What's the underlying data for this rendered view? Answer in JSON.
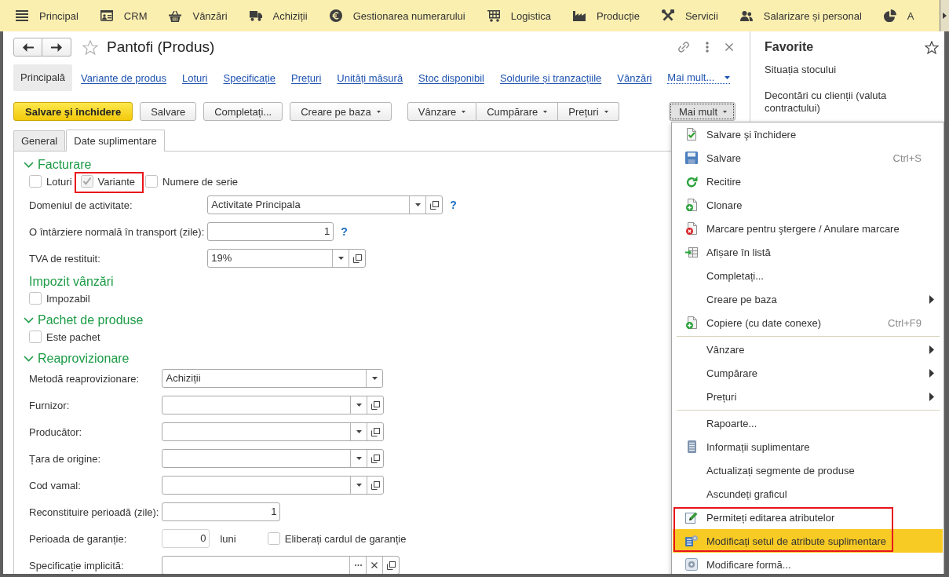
{
  "top_nav": {
    "sections": [
      {
        "label": "Principal"
      },
      {
        "label": "CRM"
      },
      {
        "label": "Vânzări"
      },
      {
        "label": "Achiziții"
      },
      {
        "label": "Gestionarea numerarului"
      },
      {
        "label": "Logistica"
      },
      {
        "label": "Producție"
      },
      {
        "label": "Servicii"
      },
      {
        "label": "Salarizare și personal"
      },
      {
        "label": "A"
      }
    ]
  },
  "form": {
    "title": "Pantofi (Produs)",
    "favorite": false,
    "nav_links": [
      {
        "label": "Principală",
        "selected": true
      },
      {
        "label": "Variante de produs",
        "selected": false
      },
      {
        "label": "Loturi",
        "selected": false
      },
      {
        "label": "Specificație",
        "selected": false
      },
      {
        "label": "Prețuri",
        "selected": false
      },
      {
        "label": "Unități măsură",
        "selected": false
      },
      {
        "label": "Stoc disponibil",
        "selected": false
      },
      {
        "label": "Soldurile și tranzacțiile",
        "selected": false
      },
      {
        "label": "Vânzări",
        "selected": false
      }
    ],
    "nav_more": {
      "label": "Mai mult..."
    },
    "toolbar": {
      "buttons": [
        {
          "label": "Salvare şi închidere",
          "kind": "primary",
          "pressed": false
        },
        {
          "label": "Salvare",
          "kind": "plain",
          "pressed": false
        },
        {
          "label": "Completați...",
          "kind": "plain",
          "pressed": false
        },
        {
          "label": "Creare pe baza",
          "kind": "dropdown",
          "pressed": false
        }
      ],
      "group": [
        {
          "label": "Vânzare",
          "kind": "dropdown",
          "pressed": false
        },
        {
          "label": "Cumpărare",
          "kind": "dropdown",
          "pressed": false
        },
        {
          "label": "Prețuri",
          "kind": "dropdown",
          "pressed": false
        }
      ],
      "more": {
        "label": "Mai mult",
        "kind": "dropdown",
        "pressed": true
      }
    },
    "tabs": [
      {
        "label": "General",
        "selected": false
      },
      {
        "label": "Date suplimentare",
        "selected": true
      }
    ],
    "sections": [
      {
        "title": "Facturare",
        "collapsible": true,
        "expanded": true,
        "rows": [
          {
            "kind": "checkboxes",
            "items": [
              {
                "label": "Loturi",
                "checked": false,
                "disabled": false,
                "highlighted": false
              },
              {
                "label": "Variante",
                "checked": true,
                "disabled": true,
                "highlighted": true
              },
              {
                "label": "Numere de serie",
                "checked": false,
                "disabled": false,
                "highlighted": false
              }
            ]
          },
          {
            "kind": "reference",
            "label": "Domeniul de activitate:",
            "value": "Activitate Principala",
            "help": "?"
          },
          {
            "kind": "number",
            "label": "O întârziere normală în transport (zile):",
            "value": "1",
            "help": "?"
          },
          {
            "kind": "reference",
            "label": "TVA de restituit:",
            "value": "19%"
          }
        ]
      },
      {
        "title": "Impozit vânzări",
        "collapsible": false,
        "rows": [
          {
            "kind": "checkboxes",
            "items": [
              {
                "label": "Impozabil",
                "checked": false,
                "disabled": false,
                "highlighted": false
              }
            ]
          }
        ]
      },
      {
        "title": "Pachet de produse",
        "collapsible": true,
        "expanded": true,
        "rows": [
          {
            "kind": "checkboxes",
            "items": [
              {
                "label": "Este pachet",
                "checked": false,
                "disabled": false,
                "highlighted": false
              }
            ]
          }
        ]
      },
      {
        "title": "Reaprovizionare",
        "collapsible": true,
        "expanded": true,
        "rows": [
          {
            "kind": "enum",
            "label": "Metodă reaprovizionare:",
            "value": "Achiziții"
          },
          {
            "kind": "reference",
            "label": "Furnizor:"
          },
          {
            "kind": "reference",
            "label": "Producător:"
          },
          {
            "kind": "reference",
            "label": "Țara de origine:"
          },
          {
            "kind": "reference",
            "label": "Cod vamal:"
          },
          {
            "kind": "number",
            "label": "Reconstituire perioadă (zile):",
            "value": "1"
          },
          {
            "kind": "number",
            "label": "Perioada de garanție:",
            "value": "0",
            "unit": "luni",
            "checkbox": {
              "label": "Eliberați cardul de garanție",
              "checked": false,
              "disabled": false,
              "highlighted": false
            }
          },
          {
            "kind": "picker",
            "label": "Specificație implicită:"
          }
        ]
      }
    ]
  },
  "favorites": {
    "title": "Favorite",
    "items": [
      {
        "label": "Situația stocului"
      },
      {
        "label": "Decontări cu clienții (valuta contractului)"
      }
    ]
  },
  "context_menu": {
    "groups": [
      {
        "items": [
          {
            "label": "Salvare şi închidere",
            "submenu": false,
            "selected": false,
            "highlighted": false
          },
          {
            "label": "Salvare",
            "shortcut": "Ctrl+S",
            "submenu": false,
            "selected": false,
            "highlighted": false
          },
          {
            "label": "Recitire",
            "submenu": false,
            "selected": false,
            "highlighted": false
          },
          {
            "label": "Clonare",
            "submenu": false,
            "selected": false,
            "highlighted": false
          },
          {
            "label": "Marcare pentru ştergere / Anulare marcare",
            "submenu": false,
            "selected": false,
            "highlighted": false
          },
          {
            "label": "Afișare în listă",
            "submenu": false,
            "selected": false,
            "highlighted": false
          },
          {
            "label": "Completați...",
            "submenu": false,
            "selected": false,
            "highlighted": false
          },
          {
            "label": "Creare pe baza",
            "submenu": true,
            "selected": false,
            "highlighted": false
          },
          {
            "label": "Copiere (cu date conexe)",
            "shortcut": "Ctrl+F9",
            "submenu": false,
            "selected": false,
            "highlighted": false
          }
        ]
      },
      {
        "items": [
          {
            "label": "Vânzare",
            "submenu": true,
            "selected": false,
            "highlighted": false
          },
          {
            "label": "Cumpărare",
            "submenu": true,
            "selected": false,
            "highlighted": false
          },
          {
            "label": "Prețuri",
            "submenu": true,
            "selected": false,
            "highlighted": false
          }
        ]
      },
      {
        "items": [
          {
            "label": "Rapoarte...",
            "submenu": false,
            "selected": false,
            "highlighted": false
          },
          {
            "label": "Informații suplimentare",
            "submenu": false,
            "selected": false,
            "highlighted": false
          },
          {
            "label": "Actualizați segmente de produse",
            "submenu": false,
            "selected": false,
            "highlighted": false
          },
          {
            "label": "Ascundeți graficul",
            "submenu": false,
            "selected": false,
            "highlighted": false
          },
          {
            "label": "Permiteți editarea atributelor",
            "submenu": false,
            "selected": false,
            "highlighted": true
          },
          {
            "label": "Modificați setul de atribute suplimentare",
            "submenu": false,
            "selected": true,
            "highlighted": true
          },
          {
            "label": "Modificare formă...",
            "submenu": false,
            "selected": false,
            "highlighted": false
          }
        ]
      }
    ]
  }
}
